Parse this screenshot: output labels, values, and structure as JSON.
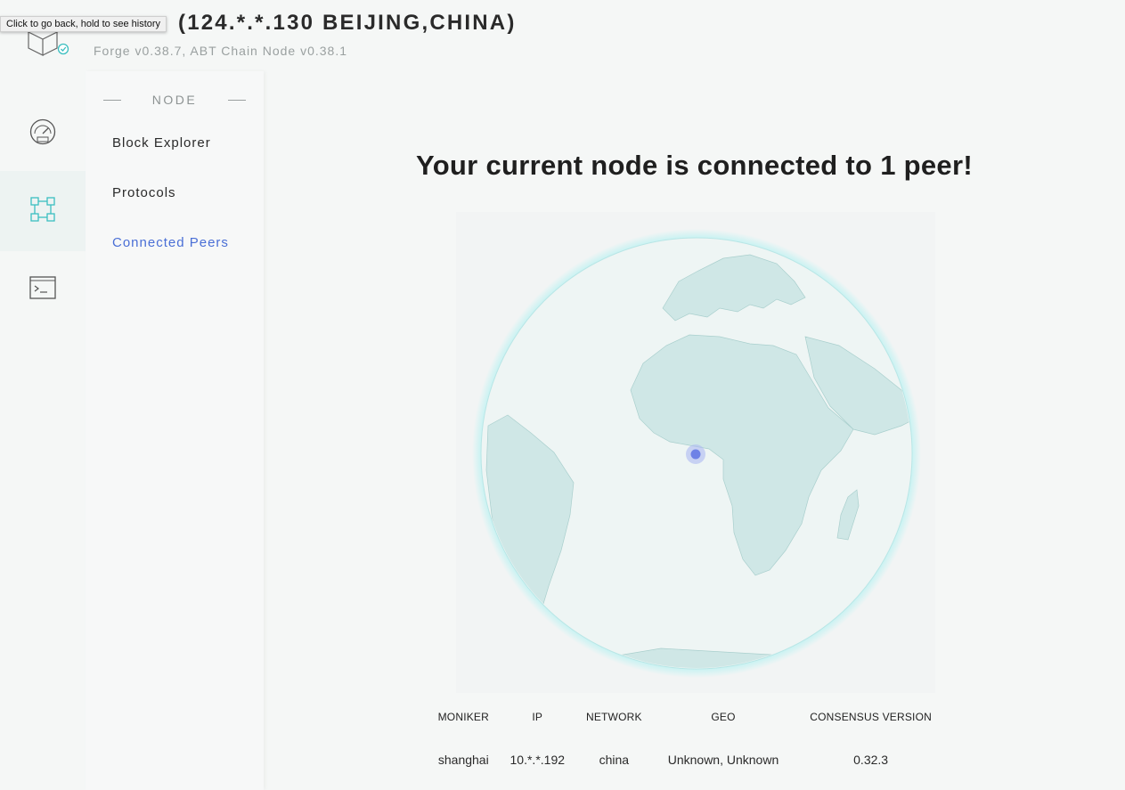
{
  "header": {
    "node_title": "(124.*.*.130 BEIJING,CHINA)",
    "subtitle": "Forge v0.38.7, ABT Chain Node v0.38.1",
    "tooltip": "Click to go back, hold to see history"
  },
  "rail": {
    "items": [
      {
        "icon": "dashboard-gauge-icon",
        "active": false
      },
      {
        "icon": "node-network-icon",
        "active": true
      },
      {
        "icon": "terminal-icon",
        "active": false
      }
    ]
  },
  "subnav": {
    "section": "NODE",
    "items": [
      {
        "label": "Block Explorer",
        "active": false
      },
      {
        "label": "Protocols",
        "active": false
      },
      {
        "label": "Connected Peers",
        "active": true
      }
    ]
  },
  "main": {
    "title": "Your current node is connected to 1 peer!"
  },
  "peers_table": {
    "columns": [
      "MONIKER",
      "IP",
      "NETWORK",
      "GEO",
      "CONSENSUS VERSION"
    ],
    "rows": [
      [
        "shanghai",
        "10.*.*.192",
        "china",
        "Unknown, Unknown",
        "0.32.3"
      ]
    ]
  },
  "colors": {
    "accent": "#4a6fd6",
    "teal": "#3bbfc0",
    "globe_glow": "#7ff0f0",
    "land": "#cfe7e6",
    "ocean": "#eaf3f2"
  }
}
